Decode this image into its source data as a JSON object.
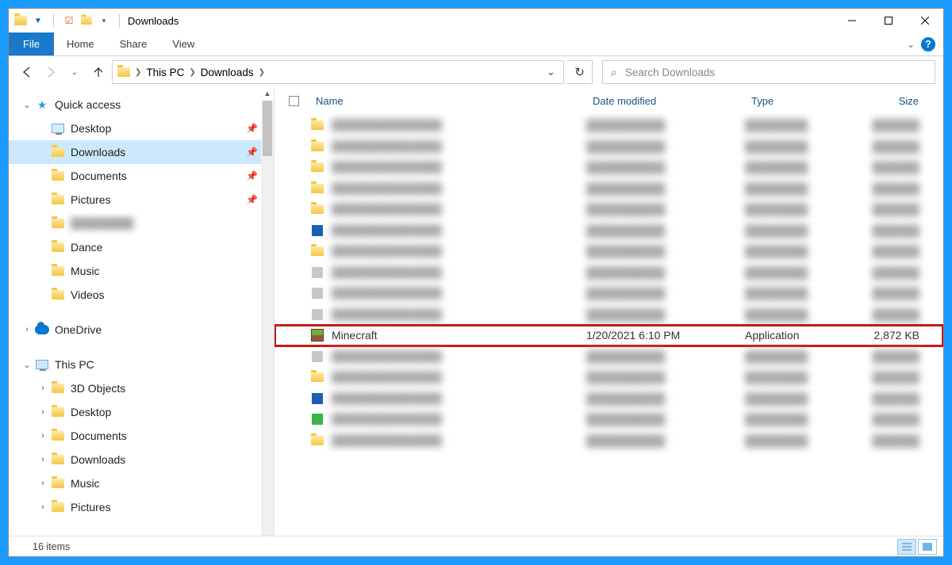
{
  "window": {
    "title": "Downloads"
  },
  "ribbon": {
    "file": "File",
    "tabs": [
      "Home",
      "Share",
      "View"
    ]
  },
  "breadcrumb": {
    "items": [
      "This PC",
      "Downloads"
    ]
  },
  "search": {
    "placeholder": "Search Downloads"
  },
  "sidebar": {
    "quick_access": {
      "label": "Quick access",
      "expanded": true
    },
    "quick_items": [
      {
        "label": "Desktop",
        "pinned": true,
        "icon": "desktop"
      },
      {
        "label": "Downloads",
        "pinned": true,
        "icon": "folder",
        "selected": true
      },
      {
        "label": "Documents",
        "pinned": true,
        "icon": "folder"
      },
      {
        "label": "Pictures",
        "pinned": true,
        "icon": "folder"
      },
      {
        "label": "████████",
        "pinned": false,
        "icon": "folder",
        "blurred": true
      },
      {
        "label": "Dance",
        "pinned": false,
        "icon": "folder"
      },
      {
        "label": "Music",
        "pinned": false,
        "icon": "folder"
      },
      {
        "label": "Videos",
        "pinned": false,
        "icon": "folder"
      }
    ],
    "onedrive": {
      "label": "OneDrive",
      "expanded": false
    },
    "thispc": {
      "label": "This PC",
      "expanded": true
    },
    "thispc_items": [
      {
        "label": "3D Objects"
      },
      {
        "label": "Desktop"
      },
      {
        "label": "Documents"
      },
      {
        "label": "Downloads"
      },
      {
        "label": "Music"
      },
      {
        "label": "Pictures"
      }
    ]
  },
  "columns": {
    "name": "Name",
    "date": "Date modified",
    "type": "Type",
    "size": "Size"
  },
  "files": [
    {
      "blurred": true,
      "icon": "folder"
    },
    {
      "blurred": true,
      "icon": "folder"
    },
    {
      "blurred": true,
      "icon": "folder"
    },
    {
      "blurred": true,
      "icon": "folder"
    },
    {
      "blurred": true,
      "icon": "folder"
    },
    {
      "blurred": true,
      "icon": "blue"
    },
    {
      "blurred": true,
      "icon": "folder"
    },
    {
      "blurred": true,
      "icon": "app"
    },
    {
      "blurred": true,
      "icon": "app"
    },
    {
      "blurred": true,
      "icon": "app"
    },
    {
      "name": "Minecraft",
      "date": "1/20/2021 6:10 PM",
      "type": "Application",
      "size": "2,872 KB",
      "icon": "minecraft",
      "highlight": true
    },
    {
      "blurred": true,
      "icon": "app"
    },
    {
      "blurred": true,
      "icon": "folder"
    },
    {
      "blurred": true,
      "icon": "blue"
    },
    {
      "blurred": true,
      "icon": "green"
    },
    {
      "blurred": true,
      "icon": "folder"
    }
  ],
  "status": {
    "text": "16 items"
  }
}
